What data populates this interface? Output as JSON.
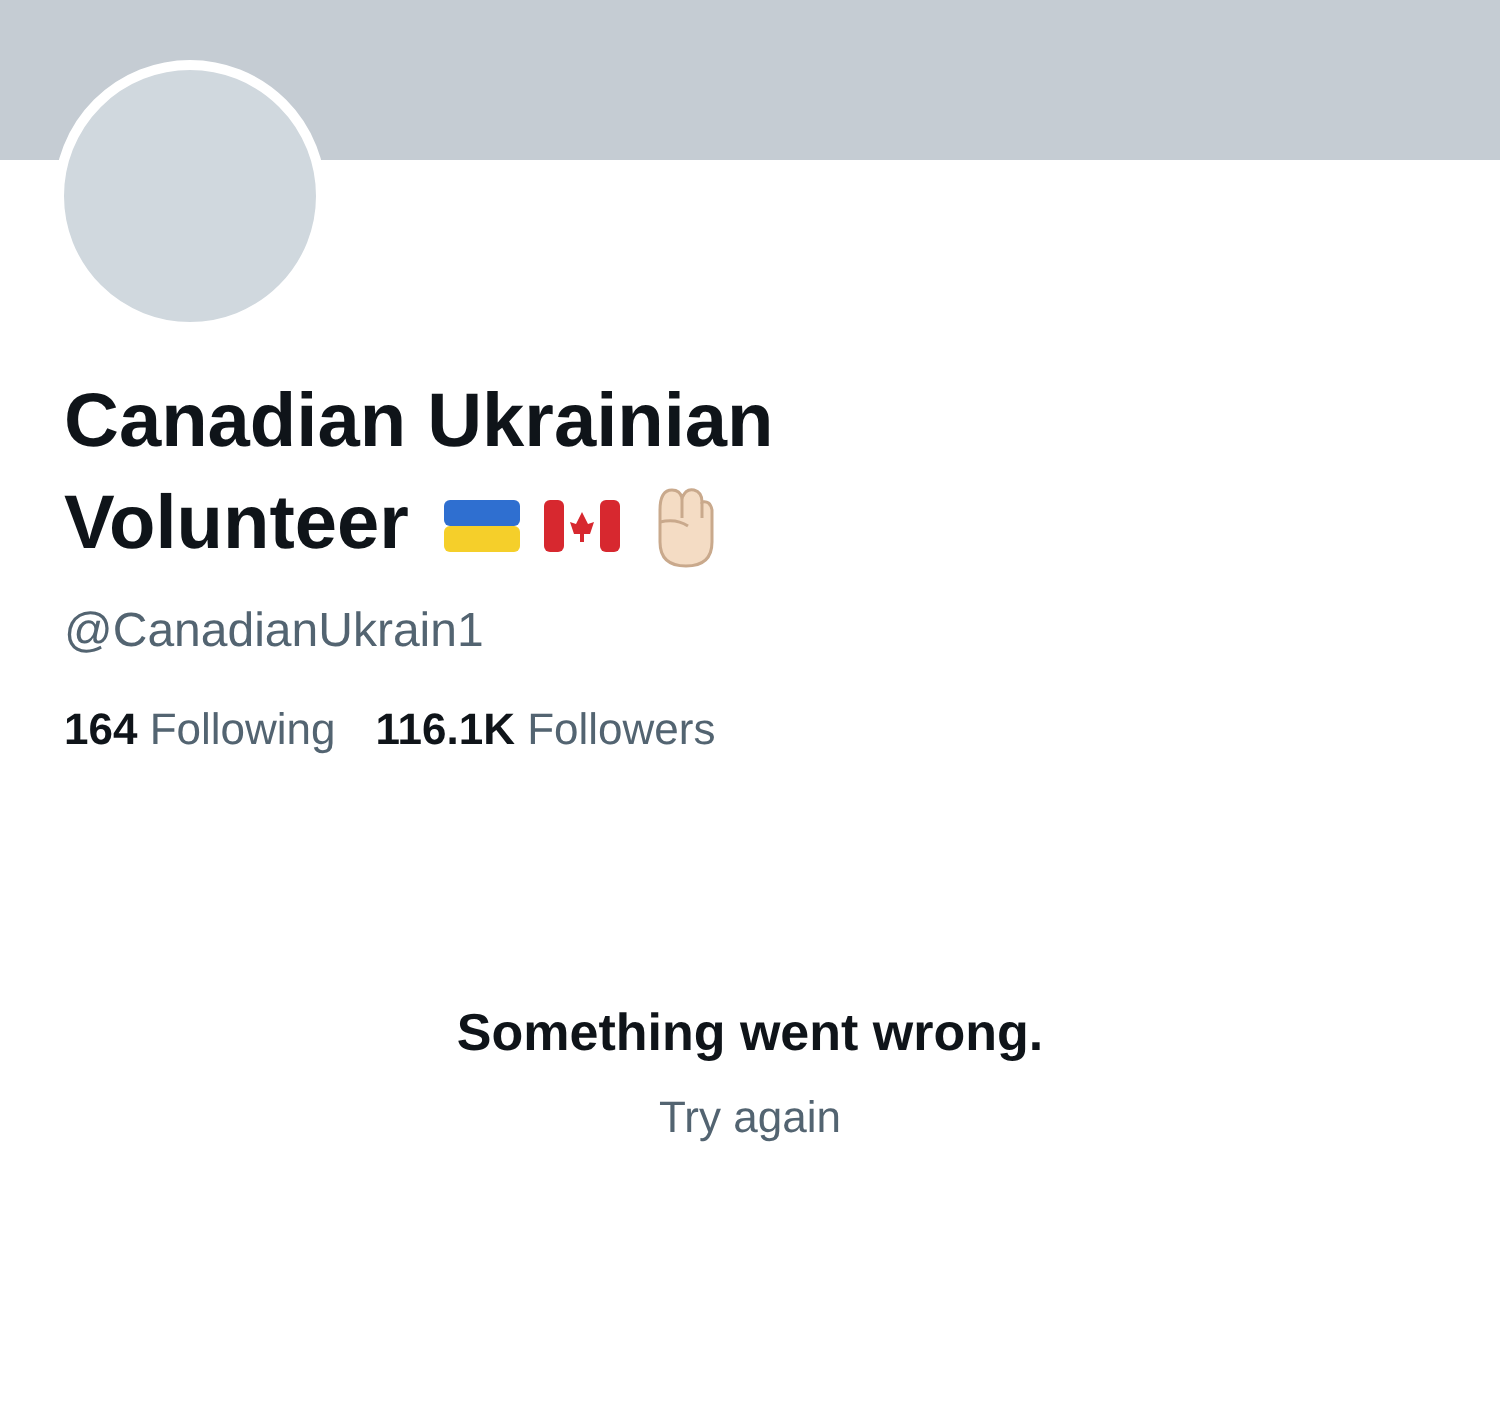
{
  "profile": {
    "name_lines": [
      "Canadian Ukrainian",
      "Volunteer"
    ],
    "handle": "@CanadianUkrain1",
    "stats": [
      {
        "count": "164",
        "label": "Following"
      },
      {
        "count": "116.1K",
        "label": "Followers"
      }
    ]
  },
  "error": {
    "message": "Something went wrong.",
    "action": "Try again"
  }
}
